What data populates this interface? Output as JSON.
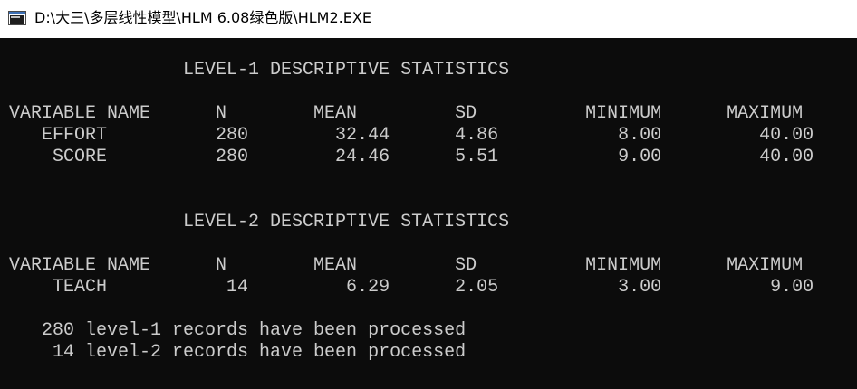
{
  "window": {
    "title": "D:\\大三\\多层线性模型\\HLM 6.08绿色版\\HLM2.EXE",
    "icon": "console-window-icon"
  },
  "console": {
    "lines": [
      "                LEVEL-1 DESCRIPTIVE STATISTICS",
      "",
      "VARIABLE NAME      N        MEAN         SD          MINIMUM      MAXIMUM",
      "   EFFORT          280        32.44      4.86           8.00         40.00",
      "    SCORE          280        24.46      5.51           9.00         40.00",
      "",
      "",
      "                LEVEL-2 DESCRIPTIVE STATISTICS",
      "",
      "VARIABLE NAME      N        MEAN         SD          MINIMUM      MAXIMUM",
      "    TEACH           14         6.29      2.05           3.00          9.00",
      "",
      "   280 level-1 records have been processed",
      "    14 level-2 records have been processed"
    ]
  }
}
